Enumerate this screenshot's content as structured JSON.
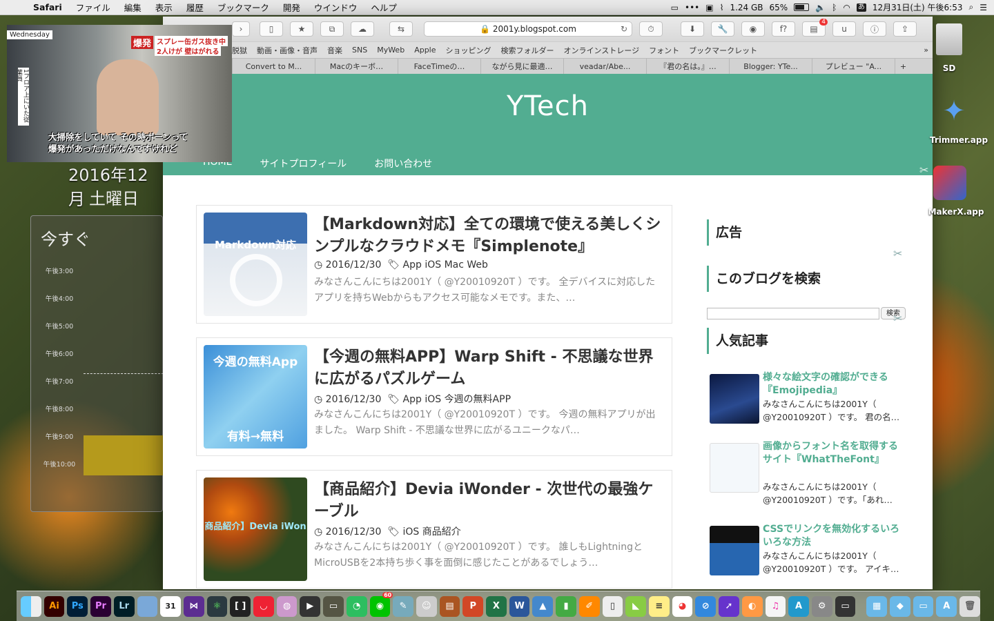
{
  "menubar": {
    "apple": "",
    "app": "Safari",
    "items": [
      "ファイル",
      "編集",
      "表示",
      "履歴",
      "ブックマーク",
      "開発",
      "ウインドウ",
      "ヘルプ"
    ],
    "memory": "1.24 GB",
    "battery": "65%",
    "ime": "あ",
    "datetime": "12月31日(土) 午後6:53"
  },
  "toolbar": {
    "url": "2001y.blogspot.com",
    "badge": "4",
    "ext_f": "f?",
    "ext_u": "u"
  },
  "bookmarks": [
    "脱獄",
    "動画・画像・音声",
    "音楽",
    "SNS",
    "MyWeb",
    "Apple",
    "ショッピング",
    "検索フォルダー",
    "オンラインストレージ",
    "フォント",
    "ブックマークレット"
  ],
  "tabs": [
    "Convert to M...",
    "Macのキーボ…",
    "FaceTimeの…",
    "ながら見に最適…",
    "veadar/Abe...",
    "『君の名は。』…",
    "Blogger: YTe...",
    "プレビュー \"A..."
  ],
  "site": {
    "title": "YTech",
    "nav": [
      "HOME",
      "サイトプロフィール",
      "お問い合わせ"
    ]
  },
  "posts": [
    {
      "title": "【Markdown対応】全ての環境で使える美しくシンプルなクラウドメモ『Simplenote』",
      "date": "2016/12/30",
      "tags": "App iOS Mac Web",
      "excerpt": "みなさんこんにちは2001Y（ @Y20010920T ）です。 全デバイスに対応したアプリを持ちWebからもアクセス可能なメモです。また、…",
      "thumb": "Markdown対応"
    },
    {
      "title": "【今週の無料APP】Warp Shift - 不思議な世界に広がるパズルゲーム",
      "date": "2016/12/30",
      "tags": "App iOS 今週の無料APP",
      "excerpt": "みなさんこんにちは2001Y（ @Y20010920T ）です。 今週の無料アプリが出ました。 Warp Shift - 不思議な世界に広がるユニークなパ…",
      "thumb": "今週の無料App",
      "thumb2": "有料→無料"
    },
    {
      "title": "【商品紹介】Devia iWonder - 次世代の最強ケーブル",
      "date": "2016/12/30",
      "tags": "iOS 商品紹介",
      "excerpt": "みなさんこんにちは2001Y（ @Y20010920T ）です。 誰しもLightningとMicroUSBを2本持ち歩く事を面倒に感じたことがあるでしょう…",
      "thumb": "商品紹介】Devia iWon"
    }
  ],
  "sidebar": {
    "ad": "広告",
    "search": "このブログを検索",
    "search_btn": "検索",
    "popular": "人気記事",
    "items": [
      {
        "title": "様々な絵文字の確認ができる『Emojipedia』",
        "excerpt": "みなさんこんにちは2001Y（ @Y20010920T ）です。 君の名…"
      },
      {
        "title": "画像からフォント名を取得するサイト『WhatTheFont』",
        "excerpt": "みなさんこんにちは2001Y（ @Y20010920T ）です。「あれ…"
      },
      {
        "title": "CSSでリンクを無効化するいろいろな方法",
        "excerpt": "みなさんこんにちは2001Y（ @Y20010920T ）です。 アイキ…"
      }
    ]
  },
  "video": {
    "channel": "Wednesday",
    "headline": "スプレー缶ガス抜き中",
    "headline2": "2人けが 壁はがれる",
    "tag": "爆発",
    "caption": "大掃除をしていて その時ボーンって",
    "caption2": "爆発があっただけなんですけれど",
    "side": "1フロア上にいた従業員"
  },
  "calendar": {
    "date": "2016年12月",
    "weekday": "土曜日",
    "now": "今すぐ",
    "hours": [
      "午後3:00",
      "午後4:00",
      "午後5:00",
      "午後6:00",
      "午後7:00",
      "午後8:00",
      "午後9:00",
      "午後10:00"
    ]
  },
  "desktop": {
    "items": [
      "SD",
      "Trimmer.app",
      "MakerX.app"
    ]
  },
  "dock": {
    "items": [
      "Ai",
      "Ps",
      "Pr",
      "Lr",
      "31"
    ],
    "line_badge": "60"
  }
}
